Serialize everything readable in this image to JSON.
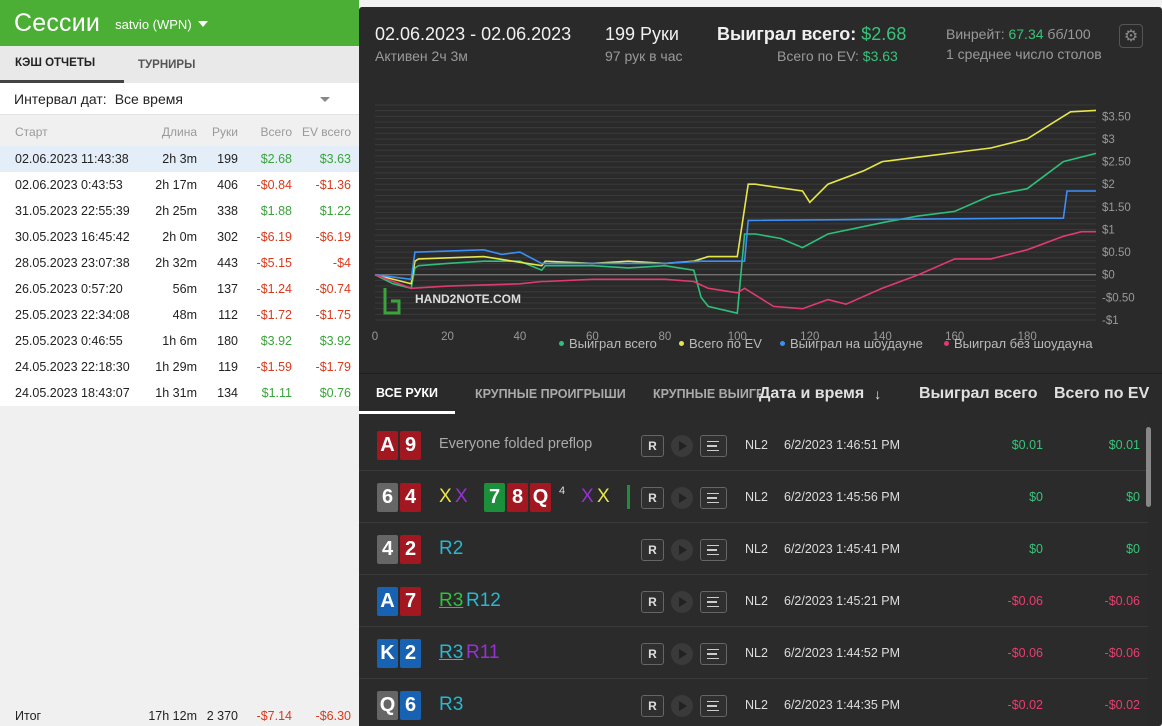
{
  "header": {
    "title": "Сессии",
    "user": "satvio (WPN)"
  },
  "left_tabs": [
    "КЭШ ОТЧЕТЫ",
    "ТУРНИРЫ"
  ],
  "interval": {
    "label": "Интервал дат:",
    "value": "Все время"
  },
  "sessions": {
    "columns": [
      "Старт",
      "Длина",
      "Руки",
      "Всего",
      "EV всего"
    ],
    "rows": [
      {
        "start": "02.06.2023 11:43:38",
        "len": "2h 3m",
        "hands": "199",
        "total": "$2.68",
        "ev": "$3.63"
      },
      {
        "start": "02.06.2023 0:43:53",
        "len": "2h 17m",
        "hands": "406",
        "total": "-$0.84",
        "ev": "-$1.36"
      },
      {
        "start": "31.05.2023 22:55:39",
        "len": "2h 25m",
        "hands": "338",
        "total": "$1.88",
        "ev": "$1.22"
      },
      {
        "start": "30.05.2023 16:45:42",
        "len": "2h 0m",
        "hands": "302",
        "total": "-$6.19",
        "ev": "-$6.19"
      },
      {
        "start": "28.05.2023 23:07:38",
        "len": "2h 32m",
        "hands": "443",
        "total": "-$5.15",
        "ev": "-$4"
      },
      {
        "start": "26.05.2023 0:57:20",
        "len": "56m",
        "hands": "137",
        "total": "-$1.24",
        "ev": "-$0.74"
      },
      {
        "start": "25.05.2023 22:34:08",
        "len": "48m",
        "hands": "112",
        "total": "-$1.72",
        "ev": "-$1.75"
      },
      {
        "start": "25.05.2023 0:46:55",
        "len": "1h 6m",
        "hands": "180",
        "total": "$3.92",
        "ev": "$3.92"
      },
      {
        "start": "24.05.2023 22:18:30",
        "len": "1h 29m",
        "hands": "119",
        "total": "-$1.59",
        "ev": "-$1.79"
      },
      {
        "start": "24.05.2023 18:43:07",
        "len": "1h 31m",
        "hands": "134",
        "total": "$1.11",
        "ev": "$0.76"
      }
    ],
    "footer": {
      "label": "Итог",
      "len": "17h 12m",
      "hands": "2 370",
      "total": "-$7.14",
      "ev": "-$6.30"
    }
  },
  "stats": {
    "date_range": "02.06.2023 - 02.06.2023",
    "active": "Активен 2ч 3м",
    "hands": "199 Руки",
    "hands_per_hour": "97 рук в час",
    "won_label": "Выиграл всего:",
    "won_value": "$2.68",
    "ev_label": "Всего по EV:",
    "ev_value": "$3.63",
    "winrate_label": "Винрейт:",
    "winrate_value": "67.34",
    "winrate_unit": "бб/100",
    "tables": "1 среднее число столов"
  },
  "chart_data": {
    "type": "line",
    "watermark": "HAND2NOTE.COM",
    "xlim": [
      0,
      199
    ],
    "ylim": [
      -1,
      3.75
    ],
    "x_ticks": [
      0,
      20,
      40,
      60,
      80,
      100,
      120,
      140,
      160,
      180
    ],
    "y_ticks": [
      "$3.50",
      "$3",
      "$2.50",
      "$2",
      "$1.50",
      "$1",
      "$0.50",
      "$0",
      "-$0.50",
      "-$1"
    ],
    "y_tick_values": [
      3.5,
      3,
      2.5,
      2,
      1.5,
      1,
      0.5,
      0,
      -0.5,
      -1
    ],
    "series": [
      {
        "name": "Выиграл всего",
        "color": "#2ebf7a",
        "x": [
          0,
          5,
          10,
          11,
          12,
          20,
          30,
          40,
          46,
          47,
          60,
          70,
          80,
          88,
          90,
          92,
          100,
          102,
          105,
          112,
          118,
          125,
          140,
          150,
          160,
          170,
          180,
          185,
          190,
          199
        ],
        "y": [
          0,
          -0.2,
          -0.3,
          0.15,
          0.2,
          0.25,
          0.3,
          0.3,
          0.1,
          0.2,
          0.2,
          0.15,
          0.2,
          0.1,
          -0.5,
          -0.7,
          -0.85,
          0.9,
          0.9,
          0.8,
          0.6,
          0.9,
          1.15,
          1.3,
          1.4,
          1.75,
          1.9,
          2.2,
          2.5,
          2.68
        ]
      },
      {
        "name": "Всего по EV",
        "color": "#e6e64a",
        "x": [
          0,
          10,
          11,
          12,
          30,
          46,
          47,
          60,
          70,
          80,
          88,
          92,
          100,
          103,
          105,
          118,
          120,
          125,
          135,
          140,
          150,
          160,
          170,
          180,
          188,
          192,
          199
        ],
        "y": [
          0,
          -0.2,
          0.3,
          0.35,
          0.4,
          0.2,
          0.3,
          0.25,
          0.3,
          0.25,
          0.3,
          0.4,
          0.4,
          2,
          2,
          1.85,
          1.6,
          2.0,
          2.3,
          2.5,
          2.6,
          2.7,
          2.8,
          3.0,
          3.4,
          3.6,
          3.63
        ]
      },
      {
        "name": "Выиграл на шоудауне",
        "color": "#3d8ef5",
        "x": [
          0,
          10,
          11,
          12,
          30,
          35,
          40,
          46,
          47,
          60,
          80,
          90,
          91,
          102,
          103,
          104,
          180,
          190,
          191,
          199
        ],
        "y": [
          0,
          -0.1,
          0.5,
          0.5,
          0.55,
          0.45,
          0.5,
          0.25,
          0.25,
          0.25,
          0.25,
          0.3,
          0.3,
          0.3,
          1.2,
          1.2,
          1.25,
          1.25,
          1.85,
          1.85
        ]
      },
      {
        "name": "Выиграл без шоудауна",
        "color": "#e03b6f",
        "x": [
          0,
          10,
          20,
          40,
          46,
          47,
          60,
          80,
          88,
          92,
          100,
          102,
          110,
          118,
          125,
          130,
          140,
          150,
          160,
          170,
          180,
          190,
          195,
          199
        ],
        "y": [
          0,
          -0.3,
          -0.25,
          -0.2,
          -0.15,
          -0.15,
          -0.1,
          -0.1,
          -0.15,
          -0.3,
          -0.4,
          -0.3,
          -0.7,
          -0.75,
          -0.55,
          -0.65,
          -0.3,
          0.0,
          0.35,
          0.35,
          0.55,
          0.85,
          0.95,
          0.95
        ]
      }
    ]
  },
  "hand_tabs": [
    "ВСЕ РУКИ",
    "КРУПНЫЕ ПРОИГРЫШИ",
    "КРУПНЫЕ ВЫИГРЫШИ"
  ],
  "hand_columns": {
    "date": "Дата и время",
    "won": "Выиграл всего",
    "ev": "Всего по EV"
  },
  "sort_arrow": "↓",
  "hands": [
    {
      "c1": "A",
      "c1cls": "cr",
      "c2": "9",
      "c2cls": "cr",
      "action": "Everyone folded preflop",
      "r": "R",
      "limit": "NL2",
      "date": "6/2/2023 1:46:51 PM",
      "won": "$0.01",
      "ev": "$0.01",
      "sign": "pg"
    },
    {
      "c1": "6",
      "c1cls": "cg",
      "c2": "4",
      "c2cls": "cr",
      "action": "",
      "board": [
        "7",
        "8",
        "Q"
      ],
      "board_count": "4",
      "r": "R",
      "limit": "NL2",
      "date": "6/2/2023 1:45:56 PM",
      "won": "$0",
      "ev": "$0",
      "sign": "pg"
    },
    {
      "c1": "4",
      "c1cls": "cg",
      "c2": "2",
      "c2cls": "cr",
      "action": "R2",
      "r": "R",
      "limit": "NL2",
      "date": "6/2/2023 1:45:41 PM",
      "won": "$0",
      "ev": "$0",
      "sign": "pg"
    },
    {
      "c1": "A",
      "c1cls": "cb",
      "c2": "7",
      "c2cls": "cr",
      "action": "R3",
      "action2": "R12",
      "r": "R",
      "limit": "NL2",
      "date": "6/2/2023 1:45:21 PM",
      "won": "-$0.06",
      "ev": "-$0.06",
      "sign": "pr"
    },
    {
      "c1": "K",
      "c1cls": "cb",
      "c2": "2",
      "c2cls": "cb",
      "action": "R3",
      "action2": "R11",
      "r": "R",
      "limit": "NL2",
      "date": "6/2/2023 1:44:52 PM",
      "won": "-$0.06",
      "ev": "-$0.06",
      "sign": "pr"
    },
    {
      "c1": "Q",
      "c1cls": "cg",
      "c2": "6",
      "c2cls": "cb",
      "action": "R3",
      "r": "R",
      "limit": "NL2",
      "date": "6/2/2023 1:44:35 PM",
      "won": "-$0.02",
      "ev": "-$0.02",
      "sign": "pr"
    }
  ]
}
